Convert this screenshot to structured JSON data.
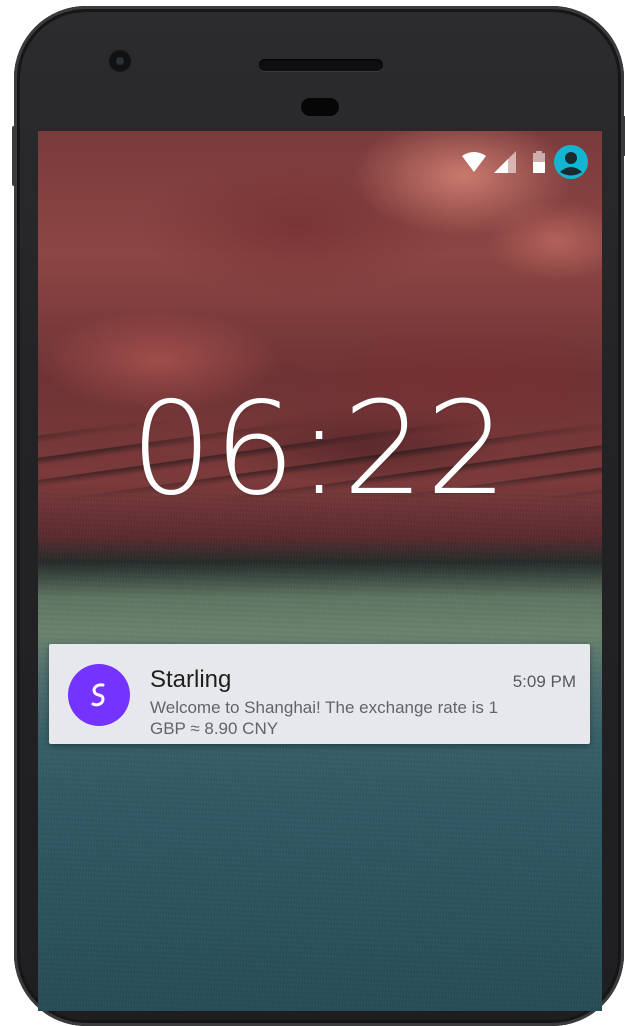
{
  "status_bar": {
    "icons": [
      "wifi-icon",
      "cell-signal-icon",
      "battery-icon",
      "user-account-icon"
    ],
    "accent_color": "#12b6d2"
  },
  "lock_screen": {
    "time": "06:22"
  },
  "notification": {
    "app_name": "Starling",
    "time": "5:09 PM",
    "message": "Welcome to Shanghai! The exchange rate is 1 GBP ≈ 8.90 CNY",
    "app_icon": "starling-logo-icon",
    "icon_color": "#7433ff"
  }
}
